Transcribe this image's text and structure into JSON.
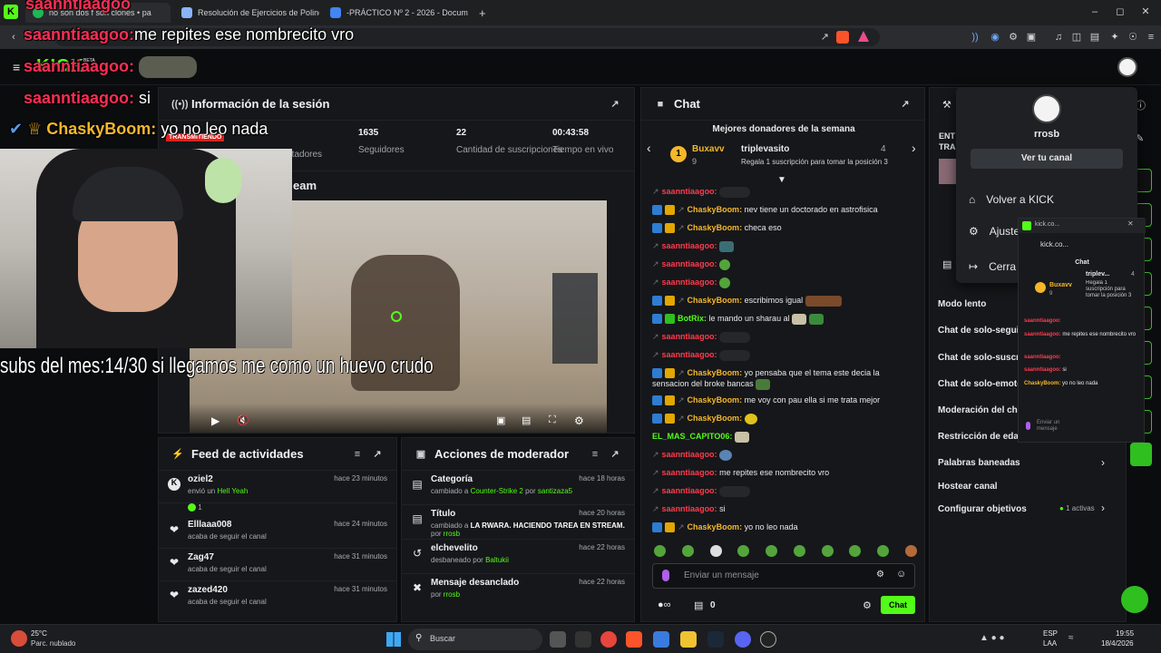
{
  "browser": {
    "tabs": [
      {
        "label": "no son dos f son clones • pa"
      },
      {
        "label": "Resolución de Ejercicios de Polinomi"
      },
      {
        "label": "-PRÁCTICO Nº 2 - 2026 - Documenta"
      }
    ],
    "new_tab": "+",
    "url_hint": "…"
  },
  "overlay": {
    "msg1_name": "saanntiaagoo:",
    "msg1_text": "me repites ese nombrecito vro",
    "msg2_name": "saanntiaagoo:",
    "msg3_name": "saanntiaagoo:",
    "msg3_text": "si",
    "msg4_name": "ChaskyBoom:",
    "msg4_text": "yo no leo nada",
    "top_name": "saanntiaagoo",
    "subs_text": "subs del mes:14/30 si llegamos me como un huevo crudo",
    "kick_logo": "KICK",
    "beta": "BETA"
  },
  "session": {
    "title": "Información de la sesión",
    "live_badge": "TRANSMITIENDO",
    "stats": [
      {
        "value": "1635",
        "label": "Seguidores"
      },
      {
        "value": "22",
        "label": "Cantidad de suscripciones"
      },
      {
        "value": "00:43:58",
        "label": "Tiempo en vivo"
      }
    ],
    "viewers_label": "espectadores",
    "stream_title_partial": "eam"
  },
  "feed": {
    "title": "Feed de actividades",
    "items": [
      {
        "name": "oziel2",
        "sub_prefix": "envió un",
        "sub_highlight": "Hell Yeah",
        "sub_extra": "1",
        "time": "hace 23 minutos"
      },
      {
        "name": "Elllaaa008",
        "sub": "acaba de seguir el canal",
        "time": "hace 24 minutos"
      },
      {
        "name": "Zag47",
        "sub": "acaba de seguir el canal",
        "time": "hace 31 minutos"
      },
      {
        "name": "zazed420",
        "sub": "acaba de seguir el canal",
        "time": "hace 31 minutos"
      }
    ]
  },
  "mod": {
    "title": "Acciones de moderador",
    "items": [
      {
        "name": "Categoría",
        "sub_prefix": "cambiado a",
        "sub_highlight": "Counter-Strike 2",
        "sub_mid": "por",
        "sub_user": "santizaza5",
        "time": "hace 18 horas"
      },
      {
        "name": "Título",
        "sub_prefix": "cambiado a",
        "sub_highlight": "LA RWARA. HACIENDO TAREA EN STREAM.",
        "sub_mid": "por",
        "sub_user": "rrosb",
        "time": "hace 20 horas"
      },
      {
        "name": "elchevelito",
        "sub_prefix": "desbaneado por",
        "sub_user": "Baltukii",
        "time": "hace 22 horas"
      },
      {
        "name": "Mensaje desanclado",
        "sub_prefix": "por",
        "sub_user": "rrosb",
        "time": "hace 22 horas"
      }
    ]
  },
  "chat": {
    "title": "Chat",
    "donors_title": "Mejores donadores de la semana",
    "donor1_name": "Buxavv",
    "donor1_count": "9",
    "donor2_name": "triplevasito",
    "donor2_count": "4",
    "donor_cta": "Regala 1 suscripción para tomar la posición 3",
    "rank": "1",
    "messages": [
      {
        "user": "saanntiaagoo:",
        "text": ""
      },
      {
        "user": "ChaskyBoom:",
        "text": "nev tiene un doctorado en astrofisica"
      },
      {
        "user": "ChaskyBoom:",
        "text": "checa eso"
      },
      {
        "user": "saanntiaagoo:",
        "text": ""
      },
      {
        "user": "saanntiaagoo:",
        "text": ""
      },
      {
        "user": "saanntiaagoo:",
        "text": ""
      },
      {
        "user": "ChaskyBoom:",
        "text": "escribimos igual"
      },
      {
        "user": "BotRix:",
        "text": "le mando un sharau al"
      },
      {
        "user": "saanntiaagoo:",
        "text": ""
      },
      {
        "user": "saanntiaagoo:",
        "text": ""
      },
      {
        "user": "ChaskyBoom:",
        "text": "yo pensaba que el tema este decia la"
      },
      {
        "user": "",
        "text": "sensacion del broke bancas"
      },
      {
        "user": "ChaskyBoom:",
        "text": "me voy con pau ella si me trata mejor"
      },
      {
        "user": "ChaskyBoom:",
        "text": ""
      },
      {
        "user": "EL_MAS_CAPITO06:",
        "text": ""
      },
      {
        "user": "saanntiaagoo:",
        "text": ""
      },
      {
        "user": "saanntiaagoo:",
        "text": "me repites ese nombrecito vro"
      },
      {
        "user": "saanntiaagoo:",
        "text": ""
      },
      {
        "user": "saanntiaagoo:",
        "text": "si"
      },
      {
        "user": "ChaskyBoom:",
        "text": "yo no leo nada"
      }
    ],
    "input_placeholder": "Enviar un mensaje",
    "points": "0",
    "send_label": "Chat"
  },
  "profile_menu": {
    "username": "rrosb",
    "view_channel": "Ver tu canal",
    "items": [
      "Volver a KICK",
      "Ajuste",
      "Cerra"
    ]
  },
  "settings": {
    "header_partial": "ENT",
    "header_partial2": "TRA",
    "items": [
      {
        "label": "Modo lento"
      },
      {
        "label": "Chat de solo-segui"
      },
      {
        "label": "Chat de solo-suscr"
      },
      {
        "label": "Chat de solo-emote"
      },
      {
        "label": "Moderación del cha"
      },
      {
        "label": "Restricción de edad"
      },
      {
        "label": "Palabras baneadas"
      },
      {
        "label": "Hostear canal"
      },
      {
        "label": "Configurar objetivos",
        "extra": "1 activas"
      }
    ]
  },
  "popup": {
    "title": "kick.co...",
    "url": "kick.co...",
    "chat_title": "Chat",
    "donor1": "Buxavv",
    "donor1_count": "9",
    "donor2": "triplev...",
    "donor2_count": "4",
    "cta": "Regala 1 suscripción para tomar la posición 3",
    "m1_user": "saanntiaagoo:",
    "m2_user": "saanntiaagoo:",
    "m2_text": "me repites ese nombrecito vro",
    "m3_user": "saanntiaagoo:",
    "m4_user": "saanntiaagoo:",
    "m4_text": "si",
    "m5_user": "ChaskyBoom:",
    "m5_text": "yo no leo nada",
    "input": "Enviar un mensaje"
  },
  "taskbar": {
    "temp": "25°C",
    "weather": "Parc. nublado",
    "search": "Buscar",
    "lang1": "ESP",
    "lang2": "LAA",
    "time": "19:55",
    "date": "18/4/2026"
  },
  "colors": {
    "accent": "#53fc18",
    "bg": "#0b0c0e",
    "panel": "#16171a"
  }
}
